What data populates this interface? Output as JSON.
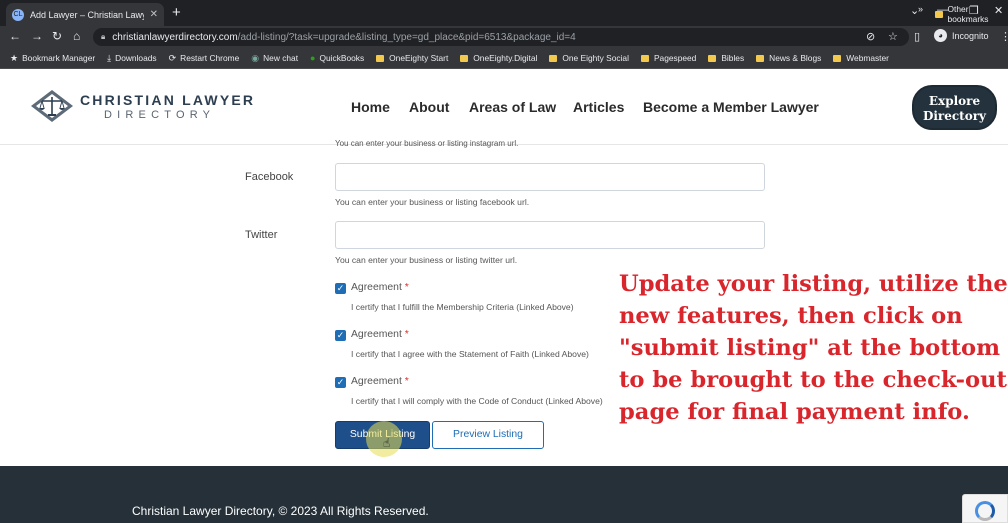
{
  "browser": {
    "tab_title": "Add Lawyer – Christian Lawyer D",
    "tab_favicon": "CL",
    "url_host": "christianlawyerdirectory.com",
    "url_path": "/add-listing/?task=upgrade&listing_type=gd_place&pid=6513&package_id=4",
    "incognito_label": "Incognito",
    "bookmarks": [
      {
        "label": "Bookmark Manager",
        "icon": "star-icon"
      },
      {
        "label": "Downloads",
        "icon": "download-icon"
      },
      {
        "label": "Restart Chrome",
        "icon": "restart-icon"
      },
      {
        "label": "New chat",
        "icon": "chat-icon"
      },
      {
        "label": "QuickBooks",
        "icon": "quickbooks-icon"
      },
      {
        "label": "OneEighty Start",
        "icon": "folder-icon"
      },
      {
        "label": "OneEighty.Digital",
        "icon": "folder-icon"
      },
      {
        "label": "One Eighty Social",
        "icon": "folder-icon"
      },
      {
        "label": "Pagespeed",
        "icon": "folder-icon"
      },
      {
        "label": "Bibles",
        "icon": "folder-icon"
      },
      {
        "label": "News & Blogs",
        "icon": "folder-icon"
      },
      {
        "label": "Webmaster",
        "icon": "folder-icon"
      }
    ],
    "bookmarks_more": "»",
    "other_bookmarks": "Other bookmarks"
  },
  "header": {
    "logo_line1": "CHRISTIAN LAWYER",
    "logo_line2": "DIRECTORY",
    "nav": [
      "Home",
      "About",
      "Areas of Law",
      "Articles",
      "Become a Member Lawyer"
    ],
    "explore_line1": "Explore",
    "explore_line2": "Directory"
  },
  "form": {
    "instagram_help": "You can enter your business or listing instagram url.",
    "facebook_label": "Facebook",
    "facebook_help": "You can enter your business or listing facebook url.",
    "twitter_label": "Twitter",
    "twitter_help": "You can enter your business or listing twitter url.",
    "agreements": [
      {
        "label": "Agreement",
        "required": "*",
        "text": "I certify that I fulfill the Membership Criteria (Linked Above)",
        "checked": true
      },
      {
        "label": "Agreement",
        "required": "*",
        "text": "I certify that I agree with the Statement of Faith (Linked Above)",
        "checked": true
      },
      {
        "label": "Agreement",
        "required": "*",
        "text": "I certify that I will comply with the Code of Conduct (Linked Above)",
        "checked": true
      }
    ],
    "submit_label": "Submit Listing",
    "preview_label": "Preview Listing"
  },
  "overlay_lines": [
    "Update your listing, utilize the",
    "new features, then click on",
    "\"submit listing\" at the bottom",
    "to be brought to the check-out",
    "page for final payment info."
  ],
  "footer": {
    "copyright": "Christian Lawyer Directory, © 2023 All Rights Reserved."
  },
  "colors": {
    "accent": "#1f4f8a",
    "overlay_text": "#d8262c",
    "footer_bg": "#253038"
  }
}
